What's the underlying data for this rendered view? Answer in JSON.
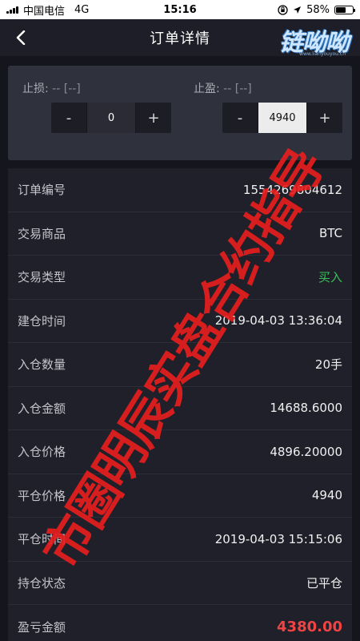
{
  "status_bar": {
    "carrier": "中国电信",
    "network": "4G",
    "time": "15:16",
    "battery": "58%",
    "battery_level": 0.58
  },
  "nav": {
    "title": "订单详情",
    "brand": "链呦呦",
    "brand_url": "www.lianyouyou.cn"
  },
  "stop_panel": {
    "stop_loss_label": "止损:",
    "stop_loss_value": "-- [--]",
    "take_profit_label": "止盈:",
    "take_profit_value": "-- [--]",
    "stop_loss_input": "0",
    "take_profit_input": "4940",
    "minus": "-",
    "plus": "+"
  },
  "details": [
    {
      "label": "订单编号",
      "value": "1554269804612"
    },
    {
      "label": "交易商品",
      "value": "BTC"
    },
    {
      "label": "交易类型",
      "value": "买入"
    },
    {
      "label": "建仓时间",
      "value": "2019-04-03 13:36:04"
    },
    {
      "label": "入仓数量",
      "value": "20手"
    },
    {
      "label": "入仓金额",
      "value": "14688.6000"
    },
    {
      "label": "入仓价格",
      "value": "4896.20000"
    },
    {
      "label": "平仓价格",
      "value": "4940"
    },
    {
      "label": "平仓时间",
      "value": "2019-04-03 15:15:06"
    },
    {
      "label": "持仓状态",
      "value": "已平仓"
    },
    {
      "label": "盈亏金额",
      "value": "4380.00"
    }
  ],
  "colors": {
    "buy_green": "#3bbf5a",
    "profit_red": "#f04343",
    "watermark_red": "#eb1e1e"
  },
  "watermark": {
    "text": "市圈明辰实盘合约指导"
  }
}
